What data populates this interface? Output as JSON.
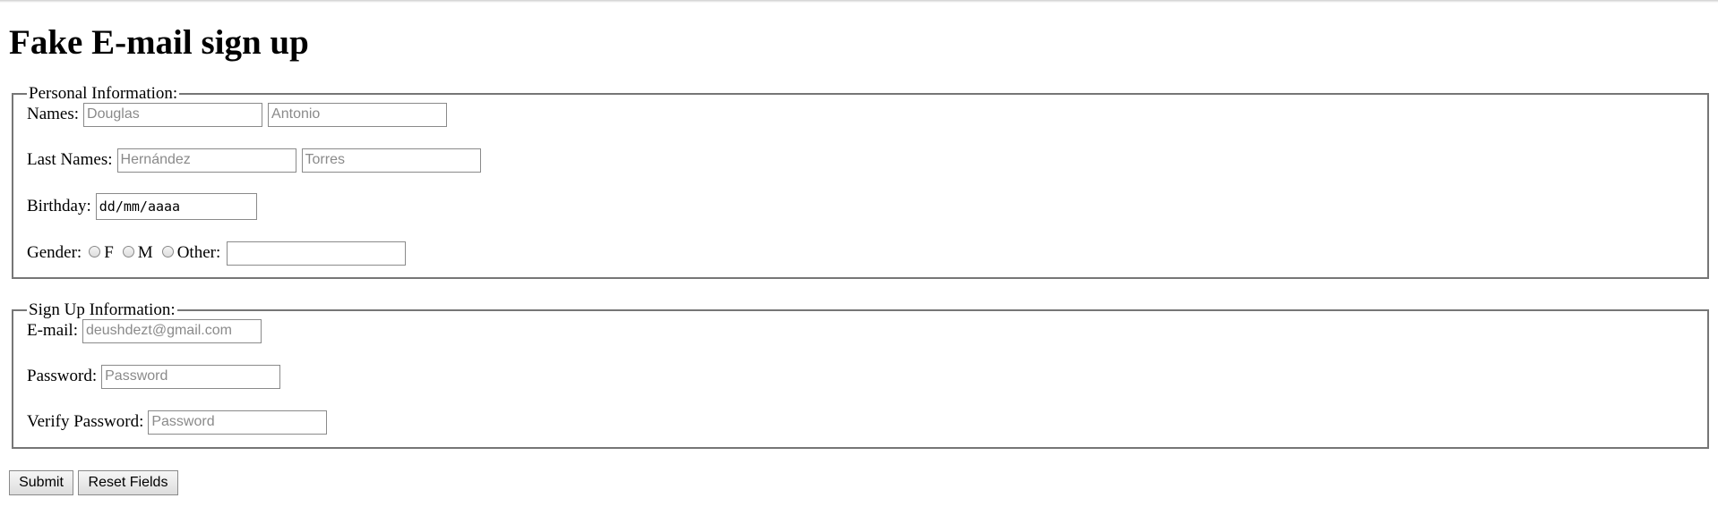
{
  "page": {
    "title": "Fake E-mail sign up"
  },
  "personal": {
    "legend": "Personal Information:",
    "names_label": "Names:",
    "first_name_placeholder": "Douglas",
    "middle_name_placeholder": "Antonio",
    "last_names_label": "Last Names:",
    "last_name1_placeholder": "Hernández",
    "last_name2_placeholder": "Torres",
    "birthday_label": "Birthday:",
    "birthday_value": "dd/mm/aaaa",
    "gender_label": "Gender:",
    "gender_options": [
      "F",
      "M",
      "Other:"
    ],
    "other_value": ""
  },
  "signup": {
    "legend": "Sign Up Information:",
    "email_label": "E-mail:",
    "email_placeholder": "deushdezt@gmail.com",
    "password_label": "Password:",
    "password_placeholder": "Password",
    "verify_label": "Verify Password:",
    "verify_placeholder": "Password"
  },
  "actions": {
    "submit_label": "Submit",
    "reset_label": "Reset Fields"
  }
}
